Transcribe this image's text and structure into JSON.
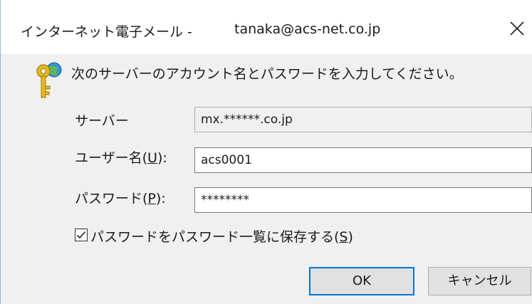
{
  "window": {
    "title_app": "インターネット電子メール -",
    "title_account": "tanaka@acs-net.co.jp",
    "close_icon": "close-icon"
  },
  "prompt": "次のサーバーのアカウント名とパスワードを入力してください。",
  "server": {
    "label": "サーバー",
    "value": "mx.******.co.jp"
  },
  "username": {
    "label_prefix": "ユーザー名(",
    "label_key": "U",
    "label_suffix": "):",
    "value": "acs0001"
  },
  "password": {
    "label_prefix": "パスワード(",
    "label_key": "P",
    "label_suffix": "):",
    "value": "********"
  },
  "save_password": {
    "checked": true,
    "label_prefix": "パスワードをパスワード一覧に保存する(",
    "label_key": "S",
    "label_suffix": ")"
  },
  "buttons": {
    "ok": "OK",
    "cancel": "キャンセル"
  },
  "colors": {
    "accent": "#0078d7",
    "dialog_bg": "#f0f0f0"
  }
}
